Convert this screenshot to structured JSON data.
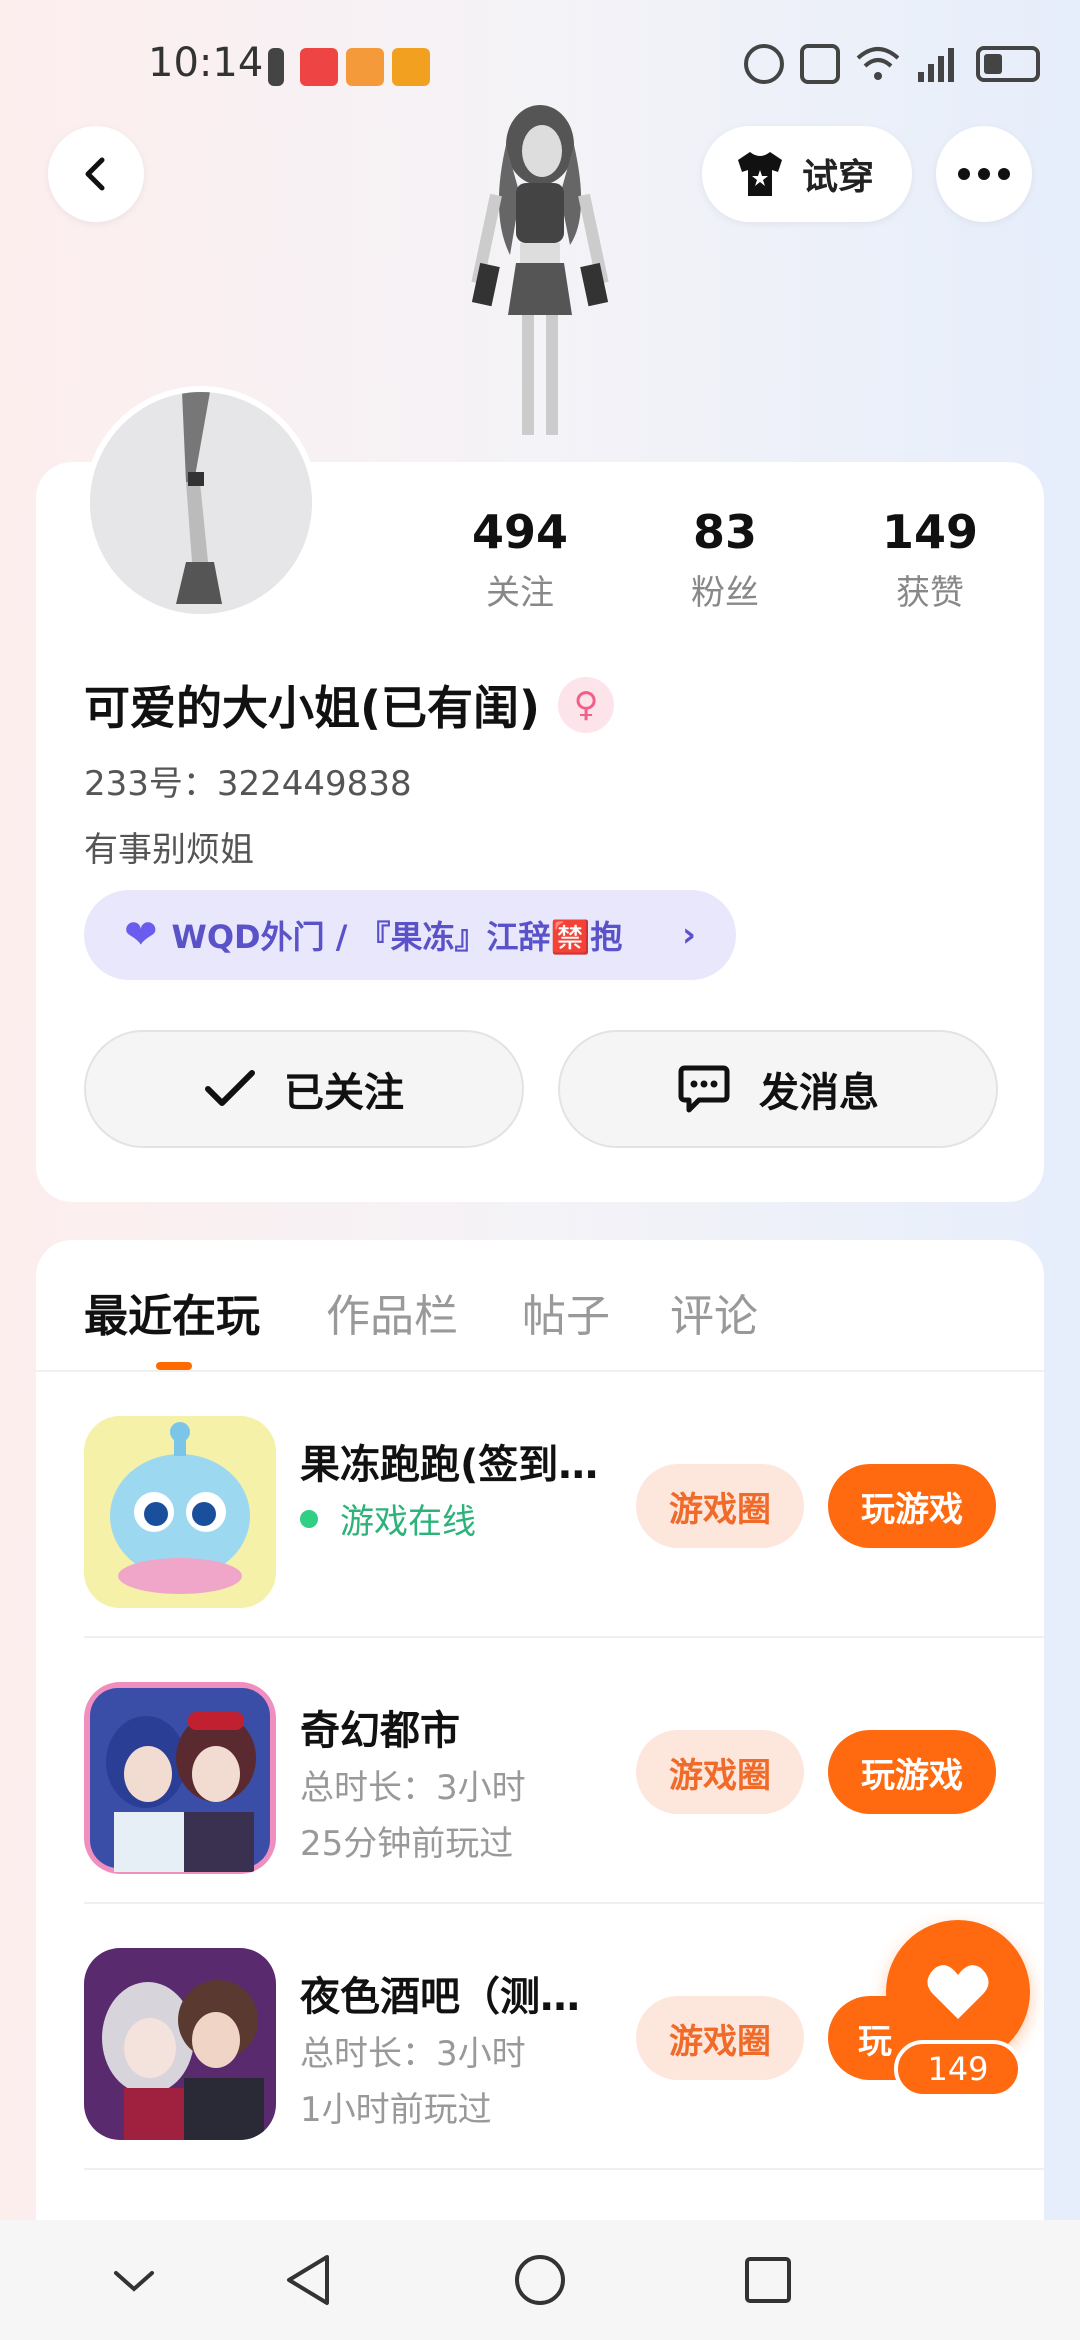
{
  "status_bar": {
    "time": "10:14"
  },
  "header": {
    "tryon_label": "试穿"
  },
  "profile": {
    "stats": [
      {
        "num": "494",
        "label": "关注"
      },
      {
        "num": "83",
        "label": "粉丝"
      },
      {
        "num": "149",
        "label": "获赞"
      }
    ],
    "username": "可爱的大小姐(已有闺)",
    "gender_symbol": "♀",
    "uid": "233号：322449838",
    "bio": "有事别烦姐",
    "group_tag": "WQD外门 / 『果冻』江辞🈲抱",
    "follow_label": "已关注",
    "message_label": "发消息"
  },
  "tabs": [
    "最近在玩",
    "作品栏",
    "帖子",
    "评论"
  ],
  "games": [
    {
      "title": "果冻跑跑(签到…",
      "line1": "游戏在线",
      "line2": "",
      "circle": "游戏圈",
      "play": "玩游戏"
    },
    {
      "title": "奇幻都市",
      "line1": "总时长：3小时",
      "line2": "25分钟前玩过",
      "circle": "游戏圈",
      "play": "玩游戏"
    },
    {
      "title": "夜色酒吧（测…",
      "line1": "总时长：3小时",
      "line2": "1小时前玩过",
      "circle": "游戏圈",
      "play": "玩"
    }
  ],
  "like_fab": {
    "count": "149"
  },
  "colors": {
    "accent": "#ff6a10",
    "online": "#2db37a",
    "group_pill": "#e9e7fb"
  }
}
